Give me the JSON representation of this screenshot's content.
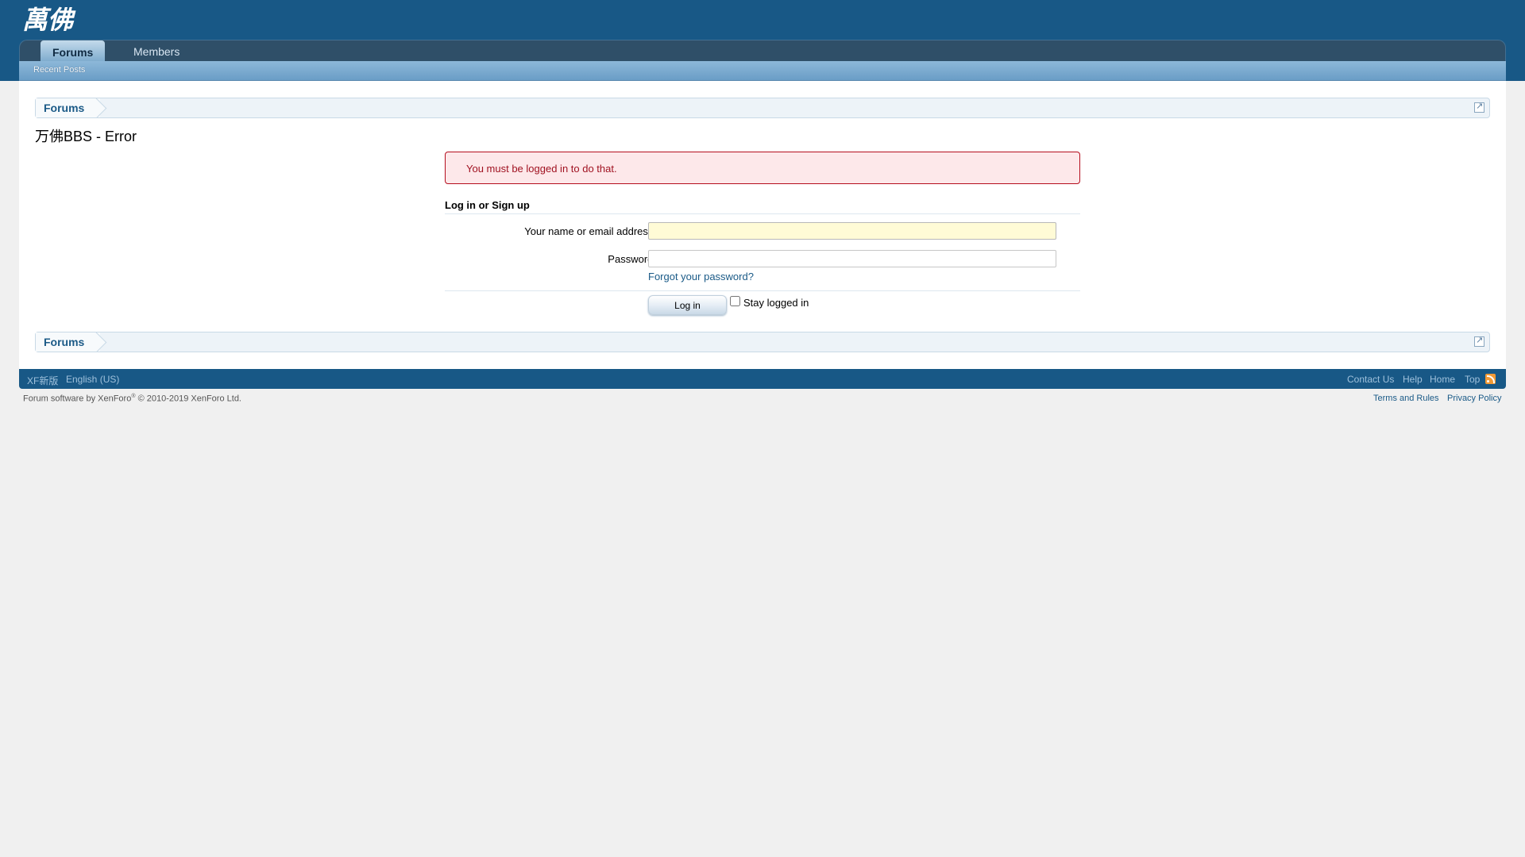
{
  "header": {
    "logo_text": "萬佛",
    "tabs": [
      {
        "label": "Forums",
        "selected": true
      },
      {
        "label": "Members",
        "selected": false
      }
    ],
    "subnav": [
      "Recent Posts"
    ]
  },
  "breadcrumb": {
    "top": "Forums",
    "bottom": "Forums"
  },
  "page": {
    "title": "万佛BBS - Error",
    "error_message": "You must be logged in to do that."
  },
  "login_form": {
    "heading": "Log in or Sign up",
    "name_label": "Your name or email address:",
    "name_value": "",
    "password_label": "Password:",
    "password_value": "",
    "forgot_link": "Forgot your password?",
    "login_button": "Log in",
    "stay_logged_in_label": "Stay logged in",
    "stay_logged_in_checked": false
  },
  "footer": {
    "left_links": [
      "XF新版",
      "English (US)"
    ],
    "right_links": [
      "Contact Us",
      "Help",
      "Home",
      "Top"
    ],
    "copyright": "Forum software by XenForo",
    "copyright_mark": "®",
    "copyright_year": " © 2010-2019 XenForo Ltd.",
    "terms": "Terms and Rules",
    "privacy": "Privacy Policy"
  },
  "colors": {
    "header_bg": "#185886",
    "error_border": "#b50d1d",
    "error_bg": "#fde8ea",
    "link": "#1a5a87",
    "rss": "#f29a35"
  }
}
